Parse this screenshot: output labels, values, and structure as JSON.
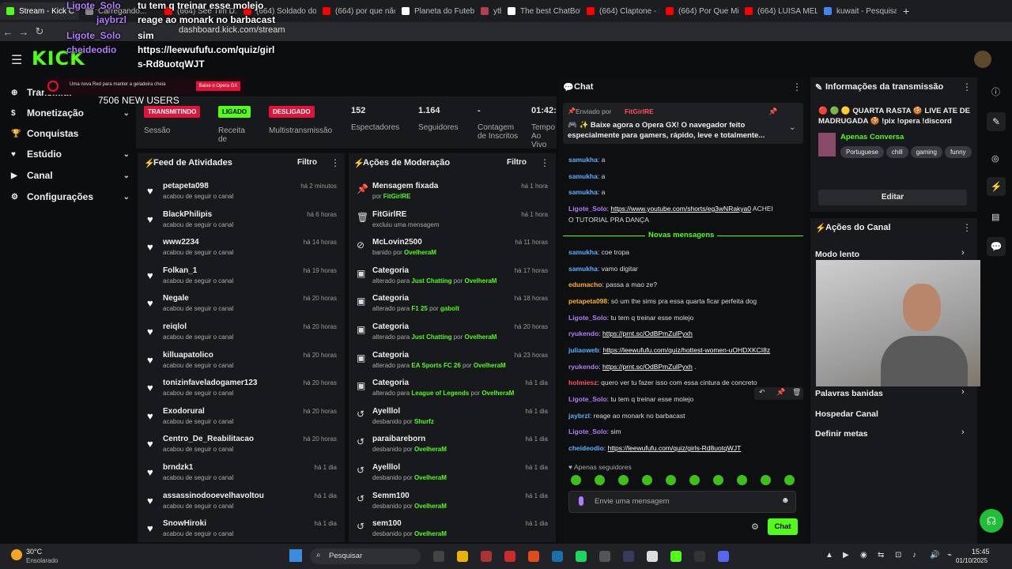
{
  "browser": {
    "tabs": [
      {
        "label": "Stream - Kick C",
        "color": "#53fc18",
        "active": true
      },
      {
        "label": "Carregando...",
        "color": "#888888",
        "active": false
      },
      {
        "label": "(664) See Tim D...",
        "color": "#ff0000",
        "active": false
      },
      {
        "label": "(664) Soldado do c",
        "color": "#ff0000",
        "active": false
      },
      {
        "label": "(664) por que não",
        "color": "#ff0000",
        "active": false
      },
      {
        "label": "Planeta do Futebol",
        "color": "#ffffff",
        "active": false
      },
      {
        "label": "ytb",
        "color": "#b04050",
        "active": false
      },
      {
        "label": "The best ChatBot a",
        "color": "#ffffff",
        "active": false
      },
      {
        "label": "(664) Claptone - Sa",
        "color": "#ff0000",
        "active": false
      },
      {
        "label": "(664) Por Que Mina",
        "color": "#ff0000",
        "active": false
      },
      {
        "label": "(664) LUISA MELL",
        "color": "#ff0000",
        "active": false
      },
      {
        "label": "kuwait - Pesquisa G",
        "color": "#4285f4",
        "active": false
      }
    ],
    "new_tab": "+",
    "url": "dashboard.kick.com/stream"
  },
  "overlay": {
    "lines": [
      {
        "user": "Ligote_Solo",
        "msg": "tu tem q treinar esse molejo"
      },
      {
        "user": "jaybrzl",
        "msg": "reage ao monark no barbacast"
      },
      {
        "user": "Ligote_Solo",
        "msg": "sim"
      },
      {
        "user": "cheideodio",
        "msg": "https://leewufufu.com/quiz/girl"
      },
      {
        "user": "",
        "msg": "s-Rd8uotqWJT"
      }
    ],
    "ad_text": "Uma nova Red para manter a geladeira cheia",
    "ad_button": "Baixe o Opera GX",
    "new_users": "7506 NEW USERS"
  },
  "header": {
    "logo": "KICK"
  },
  "sidebar": {
    "items": [
      {
        "label": "Transmitir",
        "icon": "broadcast-icon",
        "chevron": false
      },
      {
        "label": "Monetização",
        "icon": "dollar-icon",
        "chevron": true
      },
      {
        "label": "Conquistas",
        "icon": "trophy-icon",
        "chevron": false
      },
      {
        "label": "Estúdio",
        "icon": "studio-icon",
        "chevron": true
      },
      {
        "label": "Canal",
        "icon": "channel-icon",
        "chevron": true
      },
      {
        "label": "Configurações",
        "icon": "gear-icon",
        "chevron": true
      }
    ]
  },
  "stats": {
    "session": {
      "badge": "TRANSMITINDO",
      "label": "Sessão"
    },
    "revenue": {
      "badge": "LIGADO",
      "label": "Receita de"
    },
    "multi": {
      "badge": "DESLIGADO",
      "label": "Multistransmissão"
    },
    "viewers": {
      "value": "152",
      "label": "Espectadores"
    },
    "followers": {
      "value": "1.164",
      "label": "Seguidores"
    },
    "subs": {
      "value": "-",
      "label": "Contagem de Inscritos"
    },
    "time": {
      "value": "01:42:",
      "label": "Tempo Ao Vivo"
    }
  },
  "feed": {
    "title": "Feed de Atividades",
    "filter": "Filtro",
    "items": [
      {
        "name": "petapeta098",
        "sub": "acabou de seguir o canal",
        "time": "há 2 minutos"
      },
      {
        "name": "BlackPhilipis",
        "sub": "acabou de seguir o canal",
        "time": "há 6 horas"
      },
      {
        "name": "www2234",
        "sub": "acabou de seguir o canal",
        "time": "há 14 horas"
      },
      {
        "name": "Folkan_1",
        "sub": "acabou de seguir o canal",
        "time": "há 19 horas"
      },
      {
        "name": "Negale",
        "sub": "acabou de seguir o canal",
        "time": "há 20 horas"
      },
      {
        "name": "reiqlol",
        "sub": "acabou de seguir o canal",
        "time": "há 20 horas"
      },
      {
        "name": "killuapatolico",
        "sub": "acabou de seguir o canal",
        "time": "há 20 horas"
      },
      {
        "name": "tonizinfaveladogamer123",
        "sub": "acabou de seguir o canal",
        "time": "há 20 horas"
      },
      {
        "name": "Exodorural",
        "sub": "acabou de seguir o canal",
        "time": "há 20 horas"
      },
      {
        "name": "Centro_De_Reabilitacao",
        "sub": "acabou de seguir o canal",
        "time": "há 20 horas"
      },
      {
        "name": "brndzk1",
        "sub": "acabou de seguir o canal",
        "time": "há 1 dia"
      },
      {
        "name": "assassinodooevelhavoltou",
        "sub": "acabou de seguir o canal",
        "time": "há 1 dia"
      },
      {
        "name": "SnowHiroki",
        "sub": "acabou de seguir o canal",
        "time": "há 1 dia"
      }
    ]
  },
  "mod": {
    "title": "Ações de Moderação",
    "filter": "Filtro",
    "items": [
      {
        "icon": "pin-icon",
        "glyph": "📌",
        "title": "Mensagem fixada",
        "pre": "por",
        "a": "FitGirlRE",
        "mid": "",
        "b": "",
        "time": "há 1 hora"
      },
      {
        "icon": "trash-icon",
        "glyph": "🗑",
        "title": "FitGirlRE",
        "pre": "excluiu uma mensagem",
        "a": "",
        "mid": "",
        "b": "",
        "time": "há 1 hora"
      },
      {
        "icon": "ban-icon",
        "glyph": "⊘",
        "title": "McLovin2500",
        "pre": "banido por",
        "a": "OvelheraM",
        "mid": "",
        "b": "",
        "time": "há 11 horas"
      },
      {
        "icon": "category-icon",
        "glyph": "▣",
        "title": "Categoria",
        "pre": "alterado para",
        "a": "Just Chatting",
        "mid": "por",
        "b": "OvelheraM",
        "time": "há 17 horas"
      },
      {
        "icon": "category-icon",
        "glyph": "▣",
        "title": "Categoria",
        "pre": "alterado para",
        "a": "F1 25",
        "mid": "por",
        "b": "gabolt",
        "time": "há 18 horas"
      },
      {
        "icon": "category-icon",
        "glyph": "▣",
        "title": "Categoria",
        "pre": "alterado para",
        "a": "Just Chatting",
        "mid": "por",
        "b": "OvelheraM",
        "time": "há 20 horas"
      },
      {
        "icon": "category-icon",
        "glyph": "▣",
        "title": "Categoria",
        "pre": "alterado para",
        "a": "EA Sports FC 26",
        "mid": "por",
        "b": "OvelheraM",
        "time": "há 23 horas"
      },
      {
        "icon": "category-icon",
        "glyph": "▣",
        "title": "Categoria",
        "pre": "alterado para",
        "a": "League of Legends",
        "mid": "por",
        "b": "OvelheraM",
        "time": "há 1 dia"
      },
      {
        "icon": "unban-icon",
        "glyph": "↺",
        "title": "Ayelllol",
        "pre": "desbanido por",
        "a": "Shurfz",
        "mid": "",
        "b": "",
        "time": "há 1 dia"
      },
      {
        "icon": "unban-icon",
        "glyph": "↺",
        "title": "paraibareborn",
        "pre": "desbanido por",
        "a": "OvelheraM",
        "mid": "",
        "b": "",
        "time": "há 1 dia"
      },
      {
        "icon": "unban-icon",
        "glyph": "↺",
        "title": "Ayelllol",
        "pre": "desbanido por",
        "a": "OvelheraM",
        "mid": "",
        "b": "",
        "time": "há 1 dia"
      },
      {
        "icon": "unban-icon",
        "glyph": "↺",
        "title": "Semm100",
        "pre": "desbanido por",
        "a": "OvelheraM",
        "mid": "",
        "b": "",
        "time": "há 1 dia"
      },
      {
        "icon": "unban-icon",
        "glyph": "↺",
        "title": "sem100",
        "pre": "desbanido por",
        "a": "OvelheraM",
        "mid": "",
        "b": "",
        "time": "há 1 dia"
      }
    ]
  },
  "chat": {
    "title": "Chat",
    "pinned_by": "Enviado por",
    "pinned_user": "FitGirlRE",
    "pinned_text": "🎮 ✨ Baixe agora o Opera GX! O navegador feito especialmente para gamers, rápido, leve e totalmente...",
    "cutoff": "O TUTORIAL PRA DANÇA",
    "new_messages": "Novas mensagens",
    "followers_only": "Apenas seguidores",
    "input_placeholder": "Envie uma mensagem",
    "send": "Chat",
    "messages": [
      {
        "user": "samukha",
        "color": "u-b",
        "text": "a",
        "link": ""
      },
      {
        "user": "samukha",
        "color": "u-b",
        "text": "a",
        "link": ""
      },
      {
        "user": "samukha",
        "color": "u-b",
        "text": "a",
        "link": ""
      },
      {
        "user": "Ligote_Solo",
        "color": "u-p",
        "text": "",
        "link": "https://www.youtube.com/shorts/eg3wNRakya0",
        "after": " ACHEI"
      },
      {
        "user": "",
        "color": "",
        "text": "O TUTORIAL PRA DANÇA",
        "link": ""
      },
      {
        "user": "samukha",
        "color": "u-b",
        "text": "coe tropa",
        "link": ""
      },
      {
        "user": "samukha",
        "color": "u-b",
        "text": "vamo digitar",
        "link": ""
      },
      {
        "user": "edumacho",
        "color": "u-o",
        "text": "passa a mao ze?",
        "link": ""
      },
      {
        "user": "petapeta098",
        "color": "u-o",
        "text": "só um the sims pra essa quarta ficar perfeita dog",
        "link": ""
      },
      {
        "user": "Ligote_Solo",
        "color": "u-p",
        "text": "tu tem q treinar esse molejo",
        "link": ""
      },
      {
        "user": "ryukendo",
        "color": "u-p",
        "text": "",
        "link": "https://prnt.sc/OdBPmZulPyxh"
      },
      {
        "user": "juliaoweb",
        "color": "u-b",
        "text": "",
        "link": "https://leewufufu.com/quiz/hottest-women-uOHDXKCI8z"
      },
      {
        "user": "ryukendo",
        "color": "u-p",
        "text": "",
        "link": "https://prnt.sc/OdBPmZulPyxh",
        "after": " ."
      },
      {
        "user": "holmiesz",
        "color": "u-r",
        "text": "quero ver tu fazer isso com essa cintura de concreto",
        "link": ""
      },
      {
        "user": "Ligote_Solo",
        "color": "u-p",
        "text": "tu tem q treinar esse molejo",
        "link": ""
      },
      {
        "user": "jaybrzl",
        "color": "u-b",
        "text": "reage ao monark no barbacast",
        "link": ""
      },
      {
        "user": "Ligote_Solo",
        "color": "u-p",
        "text": "sim",
        "link": ""
      },
      {
        "user": "cheideodio",
        "color": "u-b",
        "text": "",
        "link": "https://leewufufu.com/quiz/girls-Rd8uotqWJT"
      }
    ]
  },
  "info": {
    "title": "Informações da transmissão",
    "stream_title": "🔴 🟢 🟡 QUARTA RASTA 🍪 LIVE ATE DE MADRUGADA 🍪 !pix !opera !discord",
    "category": "Apenas Conversa",
    "tags": [
      "Portuguese",
      "chill",
      "gaming",
      "funny"
    ],
    "edit": "Editar"
  },
  "channel_actions": {
    "title": "Ações do Canal",
    "items": [
      "Modo lento",
      "Palavras banidas",
      "Hospedar Canal",
      "Definir metas"
    ]
  },
  "taskbar": {
    "weather_temp": "30°C",
    "weather_desc": "Ensolarado",
    "search": "Pesquisar",
    "time": "15:45",
    "date": "01/10/2025"
  }
}
